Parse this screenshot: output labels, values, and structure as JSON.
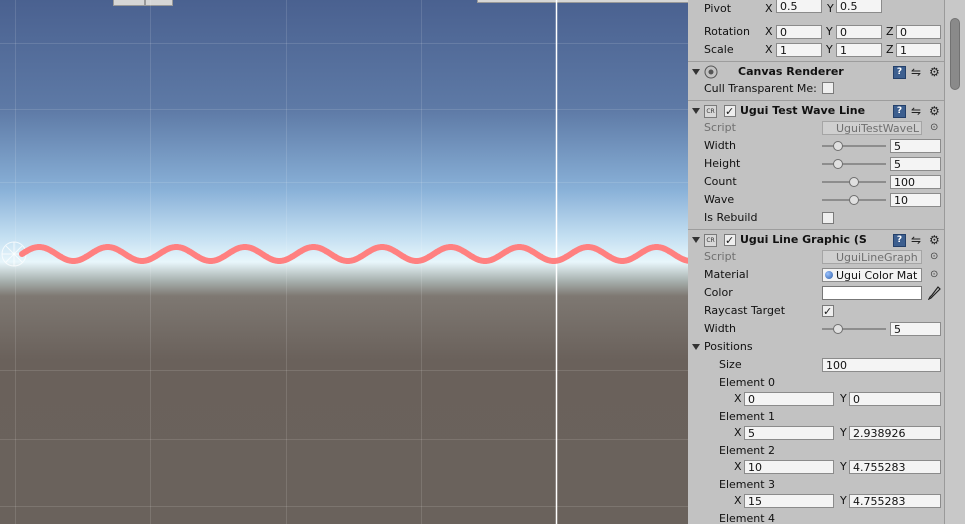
{
  "rect": {
    "pivot": {
      "label": "Pivot",
      "x_axis": "X",
      "x": "0.5",
      "y_axis": "Y",
      "y": "0.5"
    },
    "rotation": {
      "label": "Rotation",
      "x_axis": "X",
      "x": "0",
      "y_axis": "Y",
      "y": "0",
      "z_axis": "Z",
      "z": "0"
    },
    "scale": {
      "label": "Scale",
      "x_axis": "X",
      "x": "1",
      "y_axis": "Y",
      "y": "1",
      "z_axis": "Z",
      "z": "1"
    }
  },
  "canvas_renderer": {
    "title": "Canvas Renderer",
    "cull_label": "Cull Transparent Me:",
    "cull_checked": false
  },
  "wave_line": {
    "title": "Ugui Test Wave Line",
    "script_label": "Script",
    "script_value": "UguiTestWaveL",
    "width_label": "Width",
    "width": "5",
    "width_fraction": 0.25,
    "height_label": "Height",
    "height": "5",
    "height_fraction": 0.25,
    "count_label": "Count",
    "count": "100",
    "count_fraction": 0.5,
    "wave_label": "Wave",
    "wave": "10",
    "wave_fraction": 0.5,
    "rebuild_label": "Is Rebuild",
    "rebuild_checked": false
  },
  "line_graphic": {
    "title": "Ugui Line Graphic (S",
    "script_label": "Script",
    "script_value": "UguiLineGraph",
    "material_label": "Material",
    "material_value": "Ugui Color Mat",
    "color_label": "Color",
    "color_value": "#ffffff",
    "raycast_label": "Raycast Target",
    "raycast_checked": true,
    "width_label": "Width",
    "width": "5",
    "width_fraction": 0.25,
    "positions_label": "Positions",
    "size_label": "Size",
    "size": "100",
    "elements": [
      {
        "label": "Element 0",
        "x": "0",
        "y": "0"
      },
      {
        "label": "Element 1",
        "x": "5",
        "y": "2.938926"
      },
      {
        "label": "Element 2",
        "x": "10",
        "y": "4.755283"
      },
      {
        "label": "Element 3",
        "x": "15",
        "y": "4.755283"
      },
      {
        "label": "Element 4"
      }
    ]
  },
  "scene": {
    "wave_color": "#ff8080",
    "sky_top": "#4a6190",
    "horizon": "#e8f6fb",
    "ground": "#6a625c",
    "wave_count": 10
  },
  "icons": {
    "help": "?",
    "preset": "preset-icon",
    "gear": "gear-icon",
    "eyedropper": "eyedropper-icon",
    "script_component": "CR"
  }
}
